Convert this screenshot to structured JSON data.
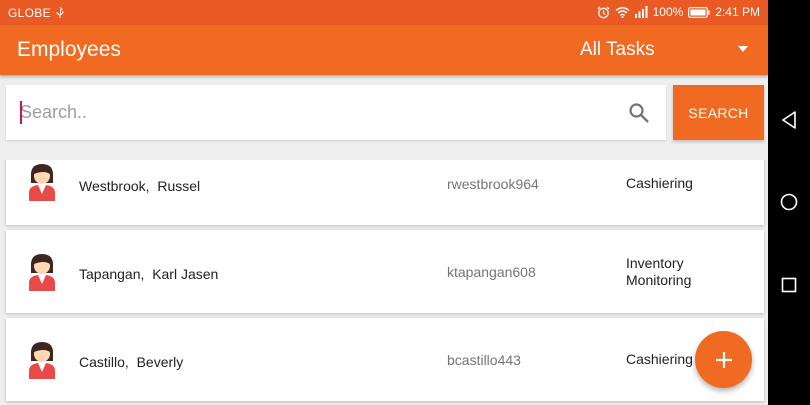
{
  "status_bar": {
    "carrier": "GLOBE",
    "battery": "100%",
    "time": "2:41 PM",
    "icons": [
      "usb-icon",
      "alarm-icon",
      "wifi-icon",
      "signal-icon",
      "battery-icon"
    ]
  },
  "app_bar": {
    "title": "Employees",
    "task_filter": "All Tasks"
  },
  "search": {
    "placeholder": "Search..",
    "value": "",
    "button_label": "SEARCH"
  },
  "employees": [
    {
      "last_name": "Westbrook,",
      "first_name": "Russel",
      "username": "rwestbrook964",
      "task_line1": "Cashiering",
      "task_line2": ""
    },
    {
      "last_name": "Tapangan,",
      "first_name": "Karl Jasen",
      "username": "ktapangan608",
      "task_line1": "Inventory",
      "task_line2": "Monitoring"
    },
    {
      "last_name": "Castillo,",
      "first_name": "Beverly",
      "username": "bcastillo443",
      "task_line1": "Cashiering",
      "task_line2": ""
    }
  ],
  "fab": {
    "icon": "plus-icon"
  },
  "colors": {
    "status_bar": "#e95a24",
    "primary": "#f06a22",
    "background": "#eeeeee",
    "caret": "#c2185b"
  }
}
